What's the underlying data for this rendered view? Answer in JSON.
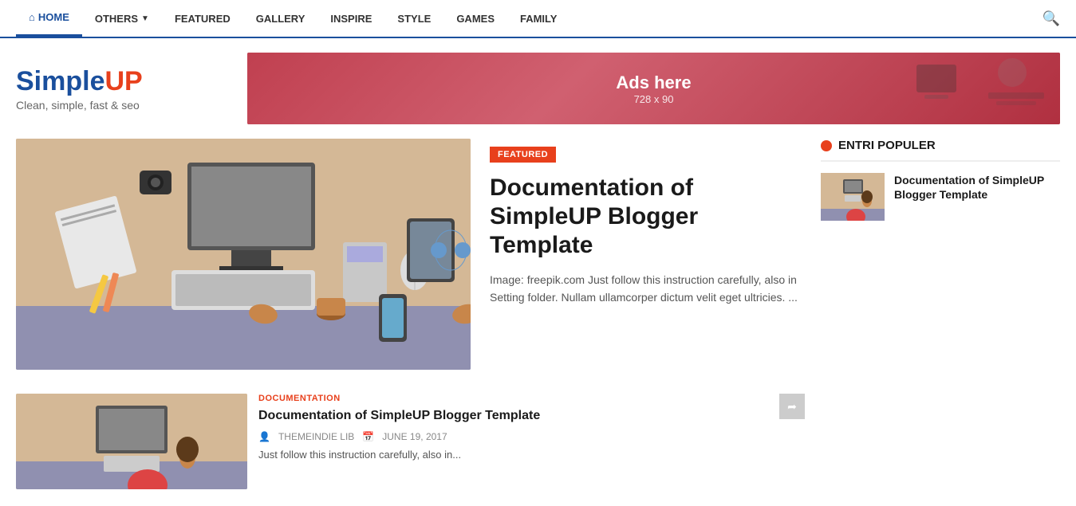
{
  "nav": {
    "items": [
      {
        "label": "HOME",
        "active": true,
        "has_icon": true
      },
      {
        "label": "OTHERS",
        "active": false,
        "has_dropdown": true
      },
      {
        "label": "FEATURED",
        "active": false
      },
      {
        "label": "GALLERY",
        "active": false
      },
      {
        "label": "INSPIRE",
        "active": false
      },
      {
        "label": "STYLE",
        "active": false
      },
      {
        "label": "GAMES",
        "active": false
      },
      {
        "label": "FAMILY",
        "active": false
      }
    ]
  },
  "header": {
    "logo_simple": "Simple",
    "logo_up": "UP",
    "logo_tagline": "Clean, simple, fast & seo",
    "ads_title": "Ads here",
    "ads_size": "728 x 90"
  },
  "featured": {
    "badge": "FEATURED",
    "title": "Documentation of SimpleUP Blogger Template",
    "excerpt": "Image: freepik.com Just follow this instruction carefully, also in Setting folder. Nullam ullamcorper dictum velit eget ultricies. ..."
  },
  "small_article": {
    "category": "DOCUMENTATION",
    "title": "Documentation of SimpleUP Blogger Template",
    "author": "THEMEINDIE LIB",
    "date": "JUNE 19, 2017",
    "excerpt": "Just follow this instruction carefully, also in..."
  },
  "sidebar": {
    "popular_label": "ENTRI POPULER",
    "popular_items": [
      {
        "title": "Documentation of SimpleUP Blogger Template"
      }
    ]
  }
}
